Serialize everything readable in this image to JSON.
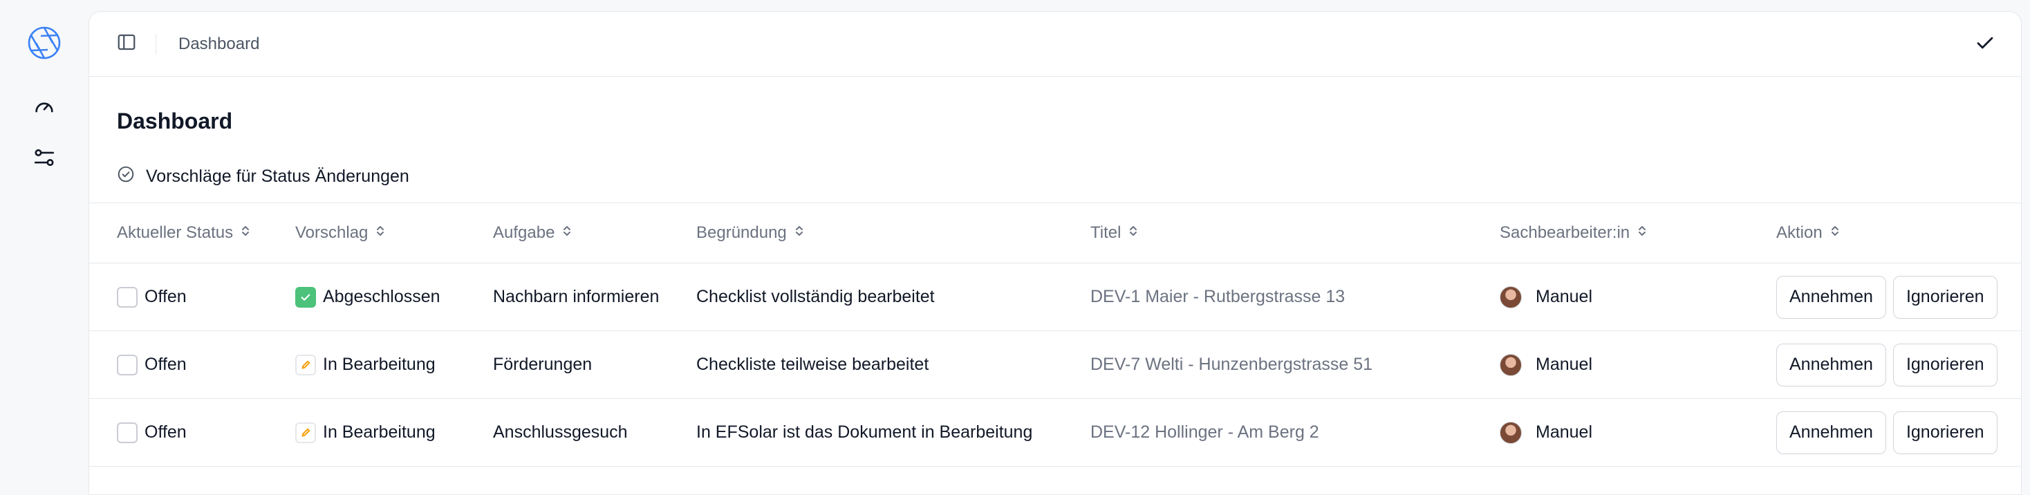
{
  "breadcrumb": "Dashboard",
  "page_title": "Dashboard",
  "section_title": "Vorschläge für Status Änderungen",
  "columns": [
    "Aktueller Status",
    "Vorschlag",
    "Aufgabe",
    "Begründung",
    "Titel",
    "Sachbearbeiter:in",
    "Aktion"
  ],
  "rows": [
    {
      "status": "Offen",
      "vorschlag": "Abgeschlossen",
      "vorschlag_kind": "done",
      "aufgabe": "Nachbarn informieren",
      "begruendung": "Checklist vollständig bearbeitet",
      "titel": "DEV-1 Maier - Rutbergstrasse 13",
      "bearbeiter": "Manuel"
    },
    {
      "status": "Offen",
      "vorschlag": "In Bearbeitung",
      "vorschlag_kind": "progress",
      "aufgabe": "Förderungen",
      "begruendung": "Checkliste teilweise bearbeitet",
      "titel": "DEV-7 Welti - Hunzenbergstrasse 51",
      "bearbeiter": "Manuel"
    },
    {
      "status": "Offen",
      "vorschlag": "In Bearbeitung",
      "vorschlag_kind": "progress",
      "aufgabe": "Anschlussgesuch",
      "begruendung": "In EFSolar ist das Dokument in Bearbeitung",
      "titel": "DEV-12 Hollinger - Am Berg 2",
      "bearbeiter": "Manuel"
    }
  ],
  "actions": {
    "accept": "Annehmen",
    "ignore": "Ignorieren"
  },
  "icons": {
    "logo": "aperture-logo-icon",
    "nav": [
      "gauge-icon",
      "settings-sliders-icon"
    ],
    "sidebar_toggle": "panel-left-icon",
    "confirm": "check-icon",
    "section": "check-circle-icon",
    "sort": "chevrons-up-down-icon"
  },
  "colors": {
    "accent": "#3b82f6",
    "done": "#4cc27a",
    "progress": "#f59e0b"
  }
}
